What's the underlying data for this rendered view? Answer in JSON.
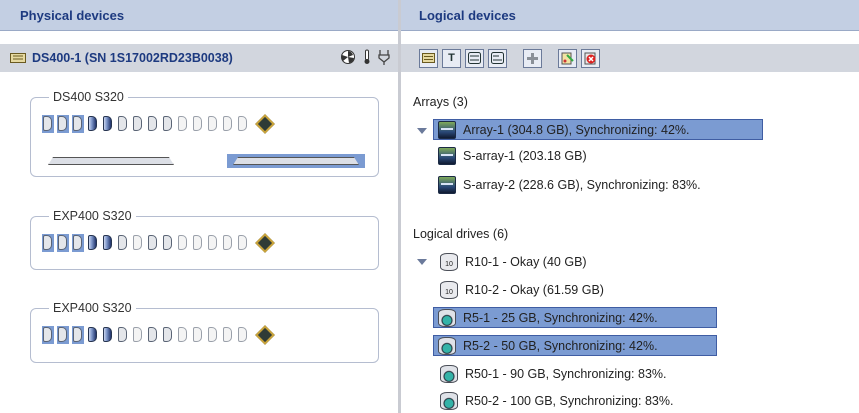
{
  "left_header": {
    "title": "Physical devices"
  },
  "right_header": {
    "title": "Logical devices"
  },
  "enclosure_bar": {
    "title": "DS400-1 (SN 1S17002RD23B0038)"
  },
  "toolbar": {
    "btn_text": "T"
  },
  "enclosures": [
    {
      "label": "DS400   S320"
    },
    {
      "label": "EXP400   S320"
    },
    {
      "label": "EXP400   S320"
    }
  ],
  "arrays": {
    "heading": "Arrays (3)",
    "items": [
      {
        "label": "Array-1 (304.8 GB), Synchronizing: 42%."
      },
      {
        "label": "S-array-1 (203.18 GB)"
      },
      {
        "label": "S-array-2 (228.6 GB), Synchronizing: 83%."
      }
    ]
  },
  "logical_drives": {
    "heading": "Logical drives (6)",
    "items": [
      {
        "label": "R10-1 - Okay (40 GB)",
        "icon_text": "10"
      },
      {
        "label": "R10-2 - Okay (61.59 GB)",
        "icon_text": "10"
      },
      {
        "label": "R5-1 - 25 GB, Synchronizing: 42%."
      },
      {
        "label": "R5-2 - 50 GB, Synchronizing: 42%."
      },
      {
        "label": "R50-1 - 90 GB, Synchronizing: 83%."
      },
      {
        "label": "R50-2 - 100 GB, Synchronizing: 83%."
      }
    ]
  },
  "colors": {
    "header_bg": "#c3cfe3",
    "header_text": "#1d3a80",
    "selection": "#7b9bd2"
  }
}
